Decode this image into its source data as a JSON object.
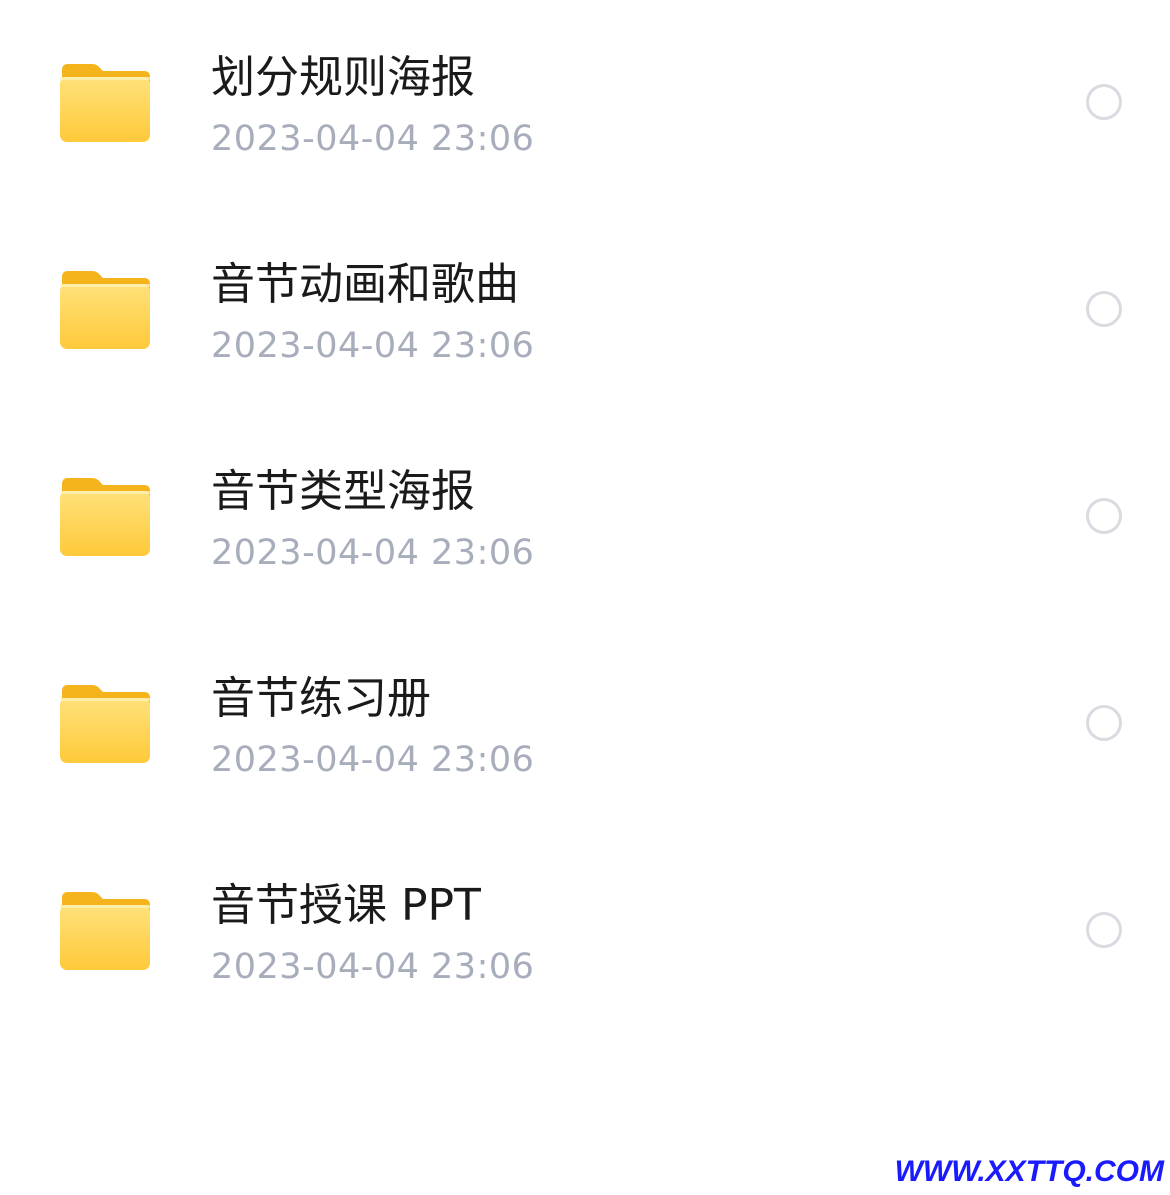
{
  "files": [
    {
      "name": "划分规则海报",
      "date": "2023-04-04 23:06",
      "icon": "folder-icon"
    },
    {
      "name": "音节动画和歌曲",
      "date": "2023-04-04 23:06",
      "icon": "folder-icon"
    },
    {
      "name": "音节类型海报",
      "date": "2023-04-04 23:06",
      "icon": "folder-icon"
    },
    {
      "name": "音节练习册",
      "date": "2023-04-04 23:06",
      "icon": "folder-icon"
    },
    {
      "name": "音节授课 PPT",
      "date": "2023-04-04 23:06",
      "icon": "folder-icon"
    }
  ],
  "watermark": "WWW.XXTTQ.COM",
  "colors": {
    "folder_back": "#f6b41c",
    "folder_front_top": "#ffe27a",
    "folder_front_bottom": "#ffc93a",
    "name_text": "#1a1a1a",
    "date_text": "#a7adbb",
    "radio_border": "#d9dbe1",
    "watermark": "#1a1aff"
  }
}
